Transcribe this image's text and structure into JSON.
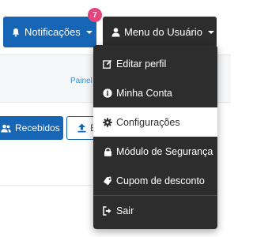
{
  "header": {
    "notifications": {
      "label": "Notificações",
      "badge_count": "7",
      "icon": "bell-icon"
    },
    "user_menu": {
      "label": "Menu do Usuário",
      "icon": "user-icon"
    },
    "breadcrumb": "Painel"
  },
  "actions": {
    "received_label": "Recebidos",
    "upload_label": "E"
  },
  "user_dropdown": {
    "items": [
      {
        "label": "Editar perfil",
        "icon": "edit-icon"
      },
      {
        "label": "Minha Conta",
        "icon": "info-icon"
      },
      {
        "label": "Configurações",
        "icon": "gear-icon",
        "selected": true
      },
      {
        "label": "Módulo de Segurança",
        "icon": "lock-icon"
      },
      {
        "label": "Cupom de desconto",
        "icon": "tag-icon"
      },
      {
        "label": "Sair",
        "icon": "sign-out-icon"
      }
    ]
  },
  "colors": {
    "primary": "#1765b5",
    "dark": "#2d2d2d",
    "badge": "#e0457b",
    "link": "#3f8fd6"
  }
}
